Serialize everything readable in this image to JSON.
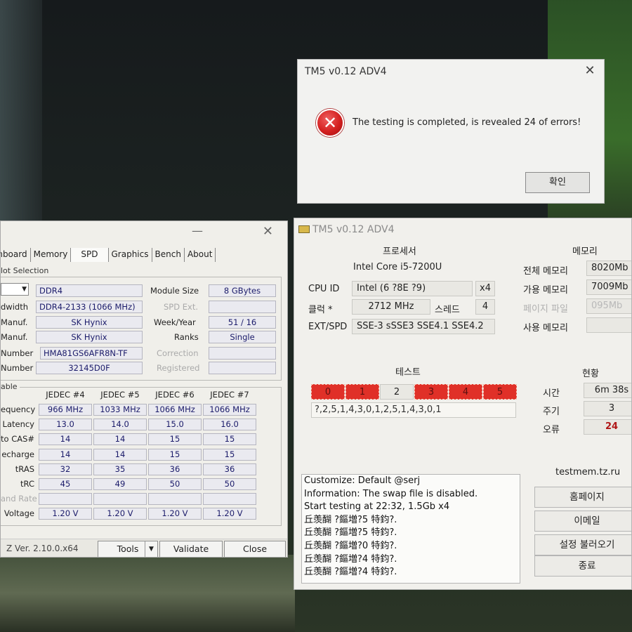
{
  "dialog": {
    "title": "TM5 v0.12 ADV4",
    "close": "✕",
    "message": "The testing is completed, is revealed 24 of errors!",
    "ok_label": "확인"
  },
  "cpuz": {
    "tabs": [
      "inboard",
      "Memory",
      "SPD",
      "Graphics",
      "Bench",
      "About"
    ],
    "active_tab": "SPD",
    "slot_selection_legend": "lot Selection",
    "type_value": "DDR4",
    "module_size_label": "Module Size",
    "module_size_value": "8 GBytes",
    "bandwidth_label": "dwidth",
    "bandwidth_value": "DDR4-2133 (1066 MHz)",
    "spd_ext_label": "SPD Ext.",
    "manuf_label": "Manuf.",
    "manuf_value": "SK Hynix",
    "week_year_label": "Week/Year",
    "week_year_value": "51 / 16",
    "dram_manuf_label": "Manuf.",
    "dram_manuf_value": "SK Hynix",
    "ranks_label": "Ranks",
    "ranks_value": "Single",
    "part_number_label": "Number",
    "part_number_value": "HMA81GS6AFR8N-TF",
    "correction_label": "Correction",
    "serial_number_label": "Number",
    "serial_number_value": "32145D0F",
    "registered_label": "Registered",
    "timings_legend": "able",
    "timings_headers": [
      "JEDEC #4",
      "JEDEC #5",
      "JEDEC #6",
      "JEDEC #7"
    ],
    "timings_rows": [
      {
        "label": "equency",
        "values": [
          "966 MHz",
          "1033 MHz",
          "1066 MHz",
          "1066 MHz"
        ]
      },
      {
        "label": "Latency",
        "values": [
          "13.0",
          "14.0",
          "15.0",
          "16.0"
        ]
      },
      {
        "label": "to CAS#",
        "values": [
          "14",
          "14",
          "15",
          "15"
        ]
      },
      {
        "label": "echarge",
        "values": [
          "14",
          "14",
          "15",
          "15"
        ]
      },
      {
        "label": "tRAS",
        "values": [
          "32",
          "35",
          "36",
          "36"
        ]
      },
      {
        "label": "tRC",
        "values": [
          "45",
          "49",
          "50",
          "50"
        ]
      },
      {
        "label": "and Rate",
        "values": [
          "",
          "",
          "",
          ""
        ]
      },
      {
        "label": "Voltage",
        "values": [
          "1.20 V",
          "1.20 V",
          "1.20 V",
          "1.20 V"
        ]
      }
    ],
    "version": "Z   Ver. 2.10.0.x64",
    "tools_label": "Tools",
    "validate_label": "Validate",
    "close_label": "Close"
  },
  "tm5": {
    "title": "TM5 v0.12 ADV4",
    "processor_header": "프로세서",
    "memory_header": "메모리",
    "cpu_name": "Intel Core i5-7200U",
    "cpu_id_label": "CPU ID",
    "cpu_id_value": "Intel  (6 ?8E ?9)",
    "cpu_id_x": "x4",
    "clock_label": "클럭 *",
    "clock_value": "2712 MHz",
    "threads_label": "스레드",
    "threads_value": "4",
    "ext_spd_label": "EXT/SPD",
    "ext_spd_value": "SSE-3 sSSE3 SSE4.1 SSE4.2",
    "total_mem_label": "전체 메모리",
    "total_mem_value": "8020Mb",
    "avail_mem_label": "가용 메모리",
    "avail_mem_value": "7009Mb",
    "page_file_label": "페이지 파일",
    "page_file_value": "095Mb",
    "used_mem_label": "사용 메모리",
    "used_mem_value": "",
    "test_header": "테스트",
    "status_header": "현황",
    "tests": [
      "0",
      "1",
      "2",
      "3",
      "4",
      "5"
    ],
    "current_test_index": 2,
    "sequence": "?,2,5,1,4,3,0,1,2,5,1,4,3,0,1",
    "time_label": "시간",
    "time_value": "6m 38s",
    "cycle_label": "주기",
    "cycle_value": "3",
    "errors_label": "오류",
    "errors_value": "24",
    "site": "testmem.tz.ru",
    "log": [
      "Customize: Default @serj",
      "Information: The swap file is disabled.",
      "Start testing at 22:32, 1.5Gb x4",
      "丘羡醐 ?鏂増?5 特鈞?.",
      "丘羡醐 ?鏂増?5 特鈞?.",
      "丘羡醐 ?鏂増?0 特鈞?.",
      "丘羡醐 ?鏂増?4 特鈞?.",
      "丘羡醐 ?鏂増?4 特鈞?."
    ],
    "btn_home": "홈페이지",
    "btn_email": "이메일",
    "btn_load": "설정 불러오기",
    "btn_exit": "종료"
  },
  "colors": {
    "error_red": "#e03028",
    "cpuz_value_blue": "#1b1b6a"
  }
}
